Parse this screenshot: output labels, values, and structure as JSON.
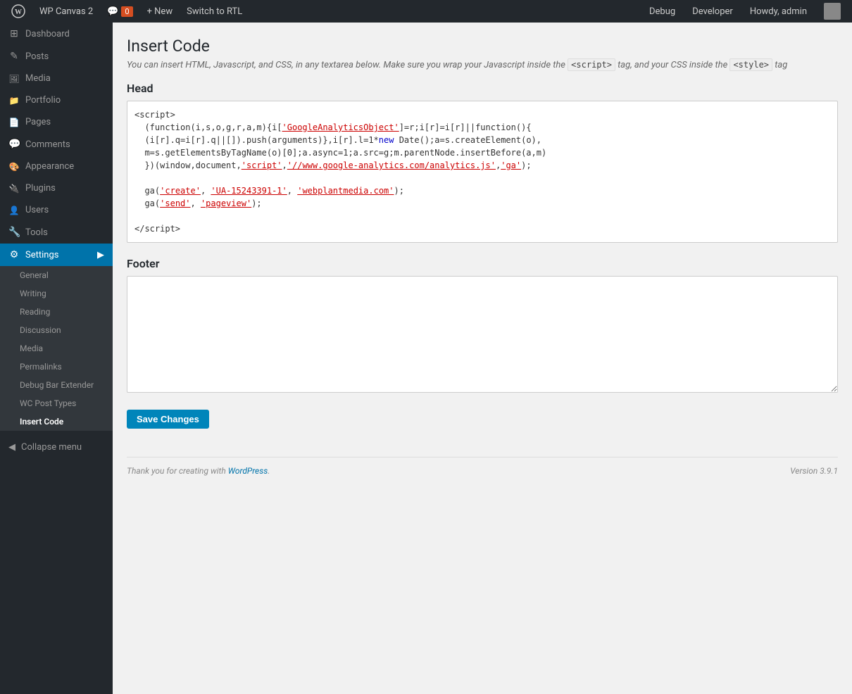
{
  "adminbar": {
    "wp_logo": "W",
    "site_name": "WP Canvas 2",
    "comments_label": "Comments",
    "comments_count": "0",
    "new_label": "+ New",
    "switch_rtl_label": "Switch to RTL",
    "debug_label": "Debug",
    "developer_label": "Developer",
    "howdy_label": "Howdy, admin"
  },
  "sidebar": {
    "items": [
      {
        "id": "dashboard",
        "label": "Dashboard",
        "icon": "⊞"
      },
      {
        "id": "posts",
        "label": "Posts",
        "icon": "✎"
      },
      {
        "id": "media",
        "label": "Media",
        "icon": "🖼"
      },
      {
        "id": "portfolio",
        "label": "Portfolio",
        "icon": "📁"
      },
      {
        "id": "pages",
        "label": "Pages",
        "icon": "📄"
      },
      {
        "id": "comments",
        "label": "Comments",
        "icon": "💬"
      },
      {
        "id": "appearance",
        "label": "Appearance",
        "icon": "🎨"
      },
      {
        "id": "plugins",
        "label": "Plugins",
        "icon": "🔌"
      },
      {
        "id": "users",
        "label": "Users",
        "icon": "👤"
      },
      {
        "id": "tools",
        "label": "Tools",
        "icon": "🔧"
      },
      {
        "id": "settings",
        "label": "Settings",
        "icon": "⚙",
        "active": true
      }
    ],
    "settings_submenu": [
      {
        "id": "general",
        "label": "General"
      },
      {
        "id": "writing",
        "label": "Writing"
      },
      {
        "id": "reading",
        "label": "Reading"
      },
      {
        "id": "discussion",
        "label": "Discussion"
      },
      {
        "id": "media",
        "label": "Media"
      },
      {
        "id": "permalinks",
        "label": "Permalinks"
      },
      {
        "id": "debug-bar-extender",
        "label": "Debug Bar Extender"
      },
      {
        "id": "wc-post-types",
        "label": "WC Post Types"
      },
      {
        "id": "insert-code",
        "label": "Insert Code",
        "active": true
      }
    ],
    "collapse_label": "Collapse menu"
  },
  "main": {
    "page_title": "Insert Code",
    "description": "You can insert HTML, Javascript, and CSS, in any textarea below. Make sure you wrap your Javascript inside the",
    "description_script_tag": "<script>",
    "description_mid": "tag, and your CSS inside the",
    "description_style_tag": "<style>",
    "description_end": "tag",
    "head_section_title": "Head",
    "head_code": "<script>\n  (function(i,s,o,g,r,a,m){i['GoogleAnalyticsObject']=r;i[r]=i[r]||function(){\n  (i[r].q=i[r].q||[]).push(arguments)},i[r].l=1*new Date();a=s.createElement(o),\n  m=s.getElementsByTagName(o)[0];a.async=1;a.src=g;m.parentNode.insertBefore(a,m)\n  })(window,document,'script','//www.google-analytics.com/analytics.js','ga');\n\n  ga('create', 'UA-15243391-1', 'webplantmedia.com');\n  ga('send', 'pageview');\n\n</script>",
    "footer_section_title": "Footer",
    "footer_code": "",
    "save_button_label": "Save Changes"
  },
  "footer": {
    "thank_you_text": "Thank you for creating with",
    "wp_link_label": "WordPress",
    "version_label": "Version 3.9.1"
  }
}
